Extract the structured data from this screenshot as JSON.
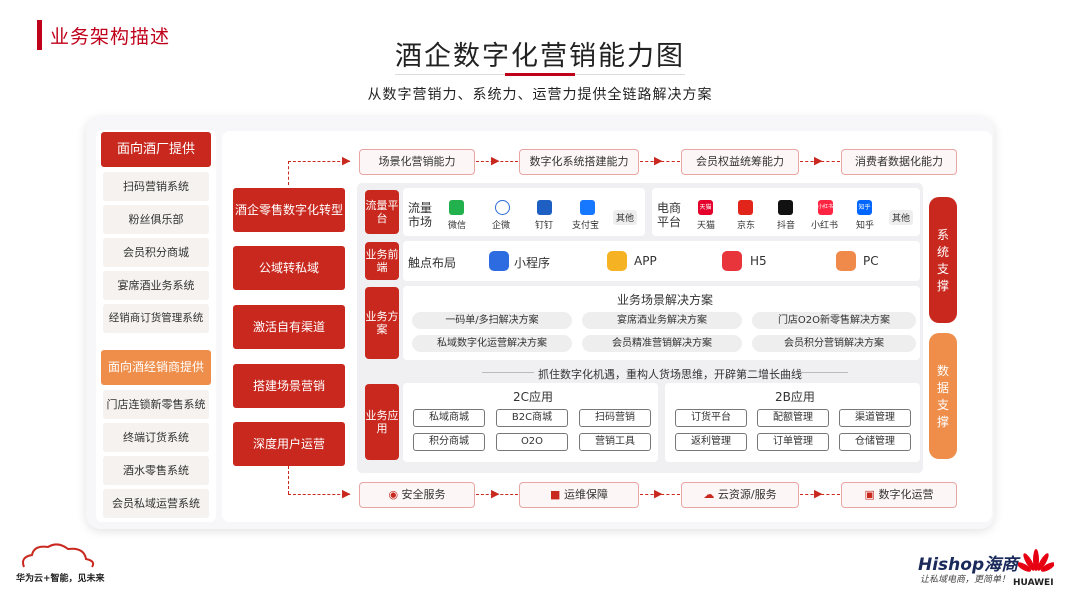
{
  "section_title": "业务架构描述",
  "main_title": "酒企数字化营销能力图",
  "subtitle": "从数字营销力、系统力、运营力提供全链路解决方案",
  "left": {
    "brewery_header": "面向酒厂提供",
    "brewery_items": [
      "扫码营销系统",
      "粉丝俱乐部",
      "会员积分商城",
      "宴席酒业务系统",
      "经销商订货管理系统"
    ],
    "dealer_header": "面向酒经销商提供",
    "dealer_items": [
      "门店连锁新零售系统",
      "终端订货系统",
      "酒水零售系统",
      "会员私域运营系统"
    ]
  },
  "red_buttons": [
    "酒企零售数字化转型",
    "公域转私域",
    "激活自有渠道",
    "搭建场景营销",
    "深度用户运营"
  ],
  "top_flow": [
    "场景化营销能力",
    "数字化系统搭建能力",
    "会员权益统筹能力",
    "消费者数据化能力"
  ],
  "bottom_flow": [
    "安全服务",
    "运维保障",
    "云资源/服务",
    "数字化运营"
  ],
  "traffic": {
    "tag": "流量平台",
    "market_label": "流量市场",
    "market_apps": [
      "微信",
      "企微",
      "钉钉",
      "支付宝"
    ],
    "market_other": "其他",
    "ecom_label": "电商平台",
    "ecom_apps": [
      "天猫",
      "京东",
      "抖音",
      "小红书",
      "知乎"
    ],
    "ecom_other": "其他",
    "ecom_icon_texts": [
      "天猫",
      "小红书",
      "知乎"
    ]
  },
  "frontend": {
    "tag": "业务前端",
    "label": "触点布局",
    "items": [
      "小程序",
      "APP",
      "H5",
      "PC"
    ]
  },
  "solutions": {
    "tag": "业务方案",
    "title": "业务场景解决方案",
    "items": [
      "一码单/多扫解决方案",
      "宴席酒业务解决方案",
      "门店O2O新零售解决方案",
      "私域数字化运营解决方案",
      "会员精准营销解决方案",
      "会员积分营销解决方案"
    ]
  },
  "slogan_mid": "抓住数字化机遇，重构人货场思维，开辟第二增长曲线",
  "apps": {
    "tag": "业务应用",
    "c_title": "2C应用",
    "c_items": [
      "私域商城",
      "B2C商城",
      "扫码营销",
      "积分商城",
      "O2O",
      "营销工具"
    ],
    "b_title": "2B应用",
    "b_items": [
      "订货平台",
      "配额管理",
      "渠道管理",
      "返利管理",
      "订单管理",
      "仓储管理"
    ]
  },
  "side_bars": {
    "system": "系统支撑",
    "data": "数据支撑"
  },
  "footer": {
    "slogan": "华为云+智能，见未来",
    "hishop": "Hishop海商",
    "hishop_sub": "让私域电商，更简单！",
    "huawei": "HUAWEI"
  },
  "colors": {
    "red": "#c8281e",
    "orange": "#ef8e4b",
    "accent": "#c0001a"
  }
}
